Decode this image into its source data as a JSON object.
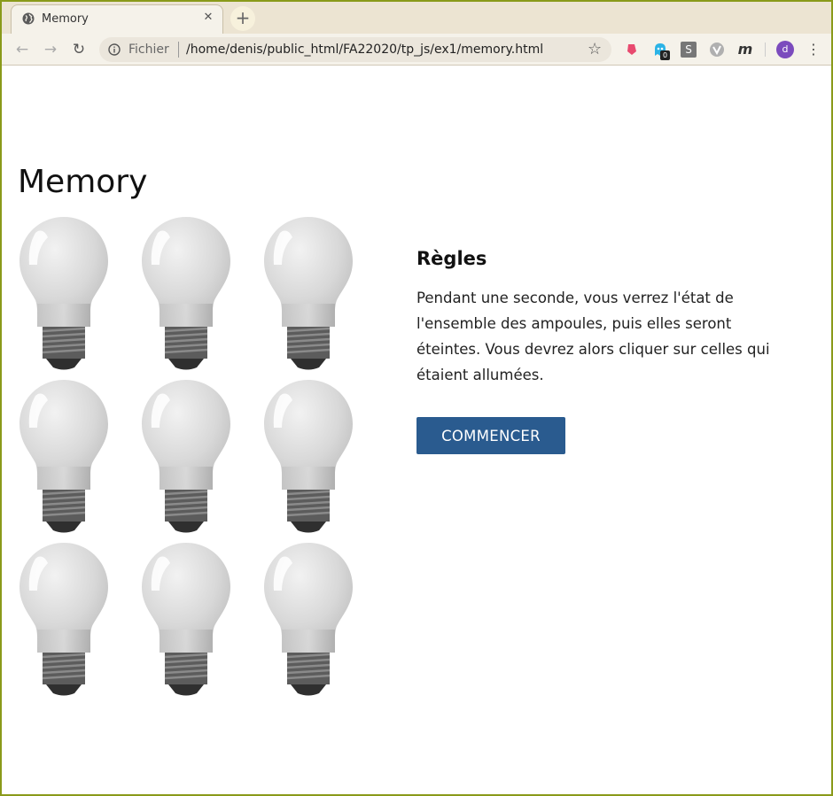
{
  "browser": {
    "tab": {
      "title": "Memory",
      "close_glyph": "✕",
      "icon": "globe-icon"
    },
    "new_tab_glyph": "+",
    "nav": {
      "back_glyph": "←",
      "forward_glyph": "→",
      "reload_glyph": "↻"
    },
    "address": {
      "scheme_label": "Fichier",
      "url": "/home/denis/public_html/FA22020/tp_js/ex1/memory.html",
      "star_glyph": "☆"
    },
    "extensions": [
      {
        "name": "tag-extension-icon",
        "color": "#e84a6f"
      },
      {
        "name": "ghost-extension-icon",
        "color": "#2bb3e6",
        "badge": "0"
      },
      {
        "name": "s-extension-icon",
        "color": "#777777",
        "letter": "S"
      },
      {
        "name": "v-extension-icon",
        "color": "#aaaaaa"
      },
      {
        "name": "m-extension-icon",
        "color": "#333333",
        "letter": "m"
      }
    ],
    "avatar_letter": "d",
    "menu_glyph": "⋮",
    "frame_color": "#8a9a1a"
  },
  "page": {
    "title": "Memory",
    "bulbs": [
      {
        "name": "bulb-1",
        "state": "off"
      },
      {
        "name": "bulb-2",
        "state": "off"
      },
      {
        "name": "bulb-3",
        "state": "off"
      },
      {
        "name": "bulb-4",
        "state": "off"
      },
      {
        "name": "bulb-5",
        "state": "off"
      },
      {
        "name": "bulb-6",
        "state": "off"
      },
      {
        "name": "bulb-7",
        "state": "off"
      },
      {
        "name": "bulb-8",
        "state": "off"
      },
      {
        "name": "bulb-9",
        "state": "off"
      }
    ],
    "rules": {
      "title": "Règles",
      "text": "Pendant une seconde, vous verrez l'état de l'ensemble des ampoules, puis elles seront éteintes. Vous devrez alors cliquer sur celles qui étaient allumées."
    },
    "start_button": "COMMENCER",
    "button_color": "#2a5b8f"
  }
}
